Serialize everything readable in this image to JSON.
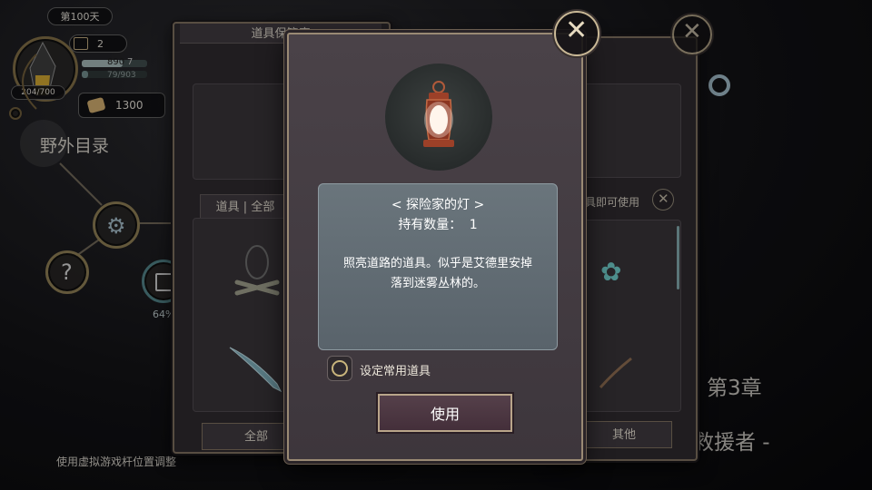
{
  "hud": {
    "day_label": "第100天",
    "calendar_count": "2",
    "hp_value": "890",
    "hp_max_partial": "7",
    "sub_value": "79/903",
    "stamina": "204/700",
    "money": "1300",
    "field_directory": "野外目录",
    "progress_percent": "64%"
  },
  "back_left": {
    "title": "道具保管库",
    "tab_label": "道具 | 全部",
    "bottom_tab": "全部"
  },
  "back_right": {
    "hint": "具即可使用",
    "bottom_tab": "其他"
  },
  "modal": {
    "item_name": "< 探险家的灯 >",
    "quantity_label": "持有数量：",
    "quantity_value": "1",
    "description_line1": "照亮道路的道具。似乎是艾德里安掉",
    "description_line2": "落到迷雾丛林的。",
    "checkbox_label": "设定常用道具",
    "use_button": "使用"
  },
  "chapter": {
    "number": "第3章",
    "subtitle": "的救援者 -"
  },
  "footer_hint": "使用虚拟游戏杆位置调整"
}
